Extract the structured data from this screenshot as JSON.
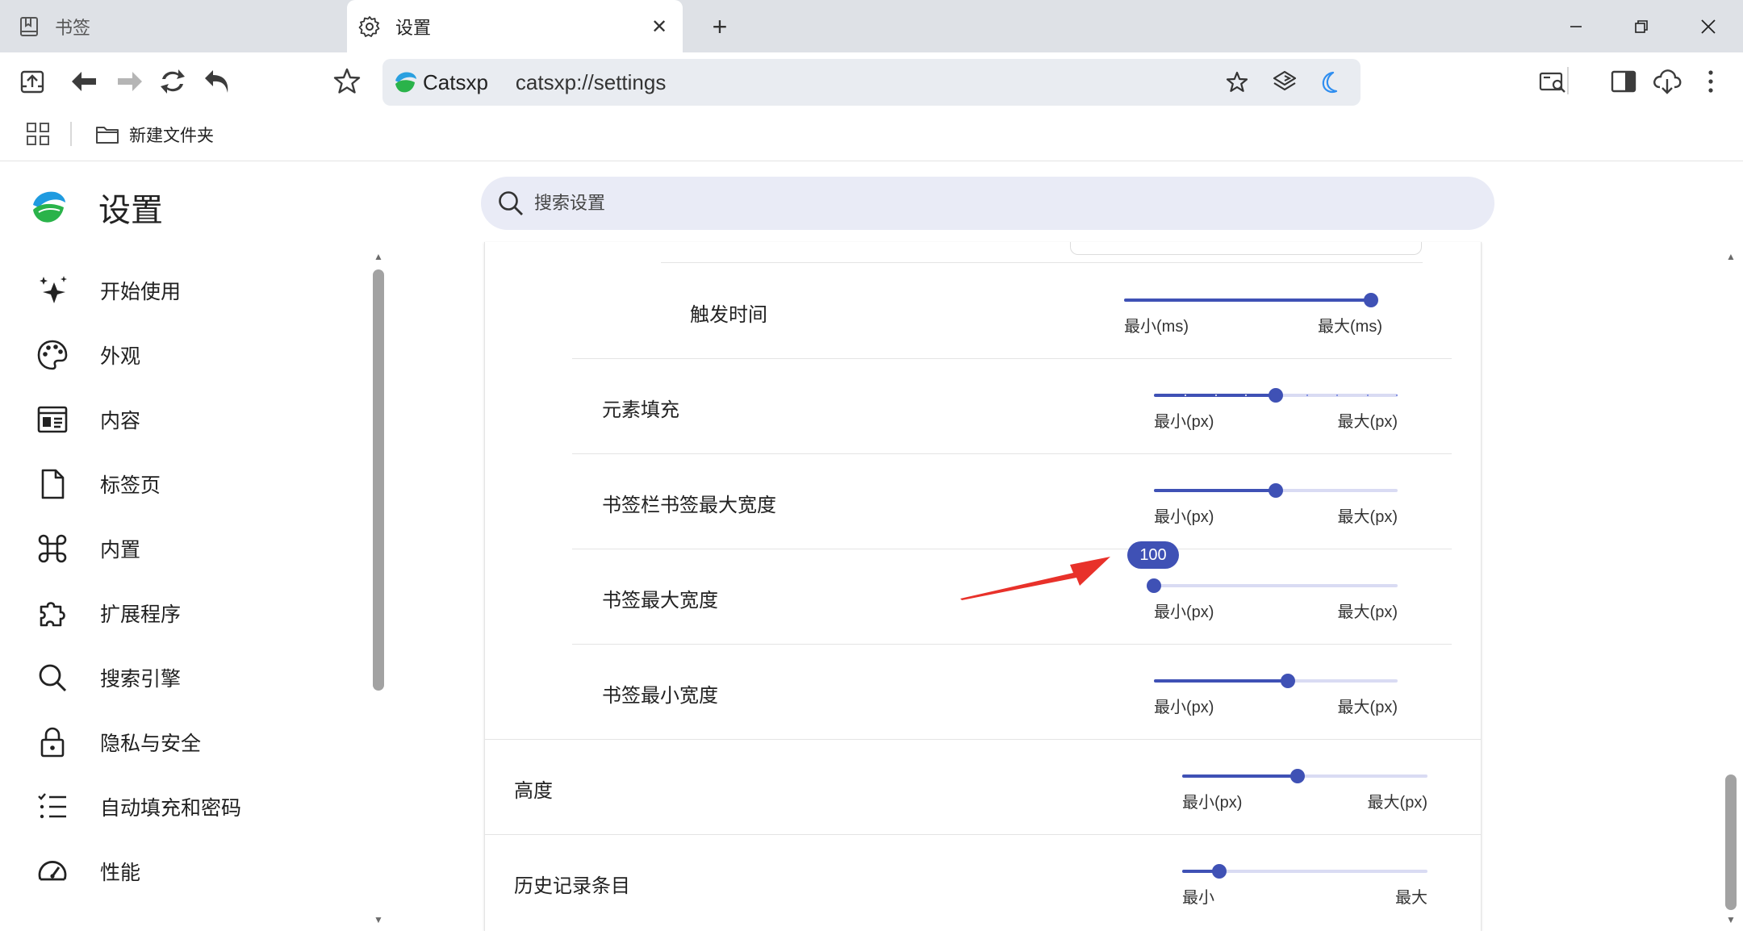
{
  "tabs": [
    {
      "label": "书签",
      "icon": "bookmark-book-icon"
    },
    {
      "label": "设置",
      "icon": "gear-icon"
    }
  ],
  "omnibox": {
    "brand": "Catsxp",
    "url": "catsxp://settings"
  },
  "bookmarks_bar": {
    "folder_label": "新建文件夹"
  },
  "settings": {
    "title": "设置",
    "search_placeholder": "搜索设置",
    "nav": [
      {
        "label": "开始使用",
        "icon": "sparkle-star-icon"
      },
      {
        "label": "外观",
        "icon": "palette-icon"
      },
      {
        "label": "内容",
        "icon": "content-card-icon"
      },
      {
        "label": "标签页",
        "icon": "page-icon"
      },
      {
        "label": "内置",
        "icon": "command-key-icon"
      },
      {
        "label": "扩展程序",
        "icon": "puzzle-icon"
      },
      {
        "label": "搜索引擎",
        "icon": "search-icon"
      },
      {
        "label": "隐私与安全",
        "icon": "lock-icon"
      },
      {
        "label": "自动填充和密码",
        "icon": "checklist-icon"
      },
      {
        "label": "性能",
        "icon": "speedometer-icon"
      }
    ]
  },
  "rows": [
    {
      "label": "触发时间",
      "min_label": "最小(ms)",
      "max_label": "最大(ms)",
      "value_fraction": 1.0
    },
    {
      "label": "元素填充",
      "min_label": "最小(px)",
      "max_label": "最大(px)",
      "value_fraction": 0.5,
      "stepped": true
    },
    {
      "label": "书签栏书签最大宽度",
      "min_label": "最小(px)",
      "max_label": "最大(px)",
      "value_fraction": 0.5
    },
    {
      "label": "书签最大宽度",
      "min_label": "最小(px)",
      "max_label": "最大(px)",
      "value_fraction": 0.0,
      "bubble": "100"
    },
    {
      "label": "书签最小宽度",
      "min_label": "最小(px)",
      "max_label": "最大(px)",
      "value_fraction": 0.55
    },
    {
      "label": "高度",
      "min_label": "最小(px)",
      "max_label": "最大(px)",
      "value_fraction": 0.47
    },
    {
      "label": "历史记录条目",
      "min_label": "最小",
      "max_label": "最大",
      "value_fraction": 0.15
    }
  ],
  "colors": {
    "accent": "#3f51b5",
    "track": "#d9dbf3",
    "arrow": "#e8312a",
    "tabstrip": "#dee1e6"
  }
}
